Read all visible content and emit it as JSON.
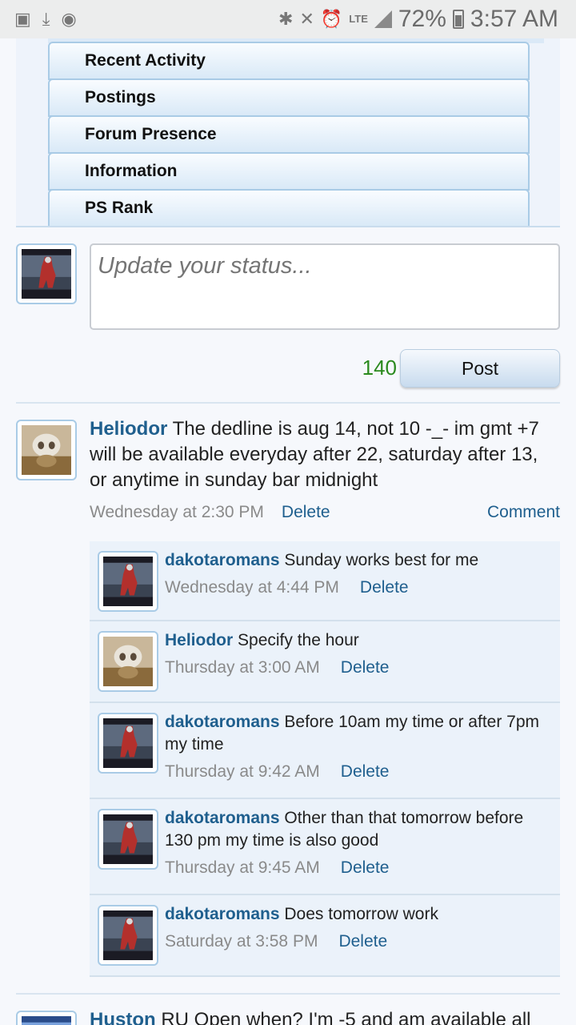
{
  "status_bar": {
    "time": "3:57 AM",
    "battery": "72%",
    "network": "LTE",
    "icons": [
      "gallery-icon",
      "download-icon",
      "spotify-icon",
      "bluetooth-icon",
      "mute-icon",
      "alarm-icon",
      "lte-icon",
      "signal-icon",
      "battery-icon"
    ]
  },
  "tabs": [
    "Recent Activity",
    "Postings",
    "Forum Presence",
    "Information",
    "PS Rank"
  ],
  "status_update": {
    "placeholder": "Update your status...",
    "counter": "140",
    "post_label": "Post"
  },
  "post": {
    "username": "Heliodor",
    "text": "The dedline is aug 14, not 10 -_- im gmt +7 will be available everyday after 22, saturday after 13, or anytime in sunday bar midnight",
    "timestamp": "Wednesday at 2:30 PM",
    "delete_label": "Delete",
    "comment_label": "Comment"
  },
  "comments": [
    {
      "username": "dakotaromans",
      "text": "Sunday works best for me",
      "timestamp": "Wednesday at 4:44 PM",
      "delete_label": "Delete",
      "avatar": "red-character"
    },
    {
      "username": "Heliodor",
      "text": "Specify the hour",
      "timestamp": "Thursday at 3:00 AM",
      "delete_label": "Delete",
      "avatar": "cubone"
    },
    {
      "username": "dakotaromans",
      "text": "Before 10am my time or after 7pm my time",
      "timestamp": "Thursday at 9:42 AM",
      "delete_label": "Delete",
      "avatar": "red-character"
    },
    {
      "username": "dakotaromans",
      "text": "Other than that tomorrow before 130 pm my time is also good",
      "timestamp": "Thursday at 9:45 AM",
      "delete_label": "Delete",
      "avatar": "red-character"
    },
    {
      "username": "dakotaromans",
      "text": "Does tomorrow work",
      "timestamp": "Saturday at 3:58 PM",
      "delete_label": "Delete",
      "avatar": "red-character"
    }
  ],
  "next_post": {
    "username": "Huston",
    "text": "RU Open when? I'm -5 and am available all"
  }
}
